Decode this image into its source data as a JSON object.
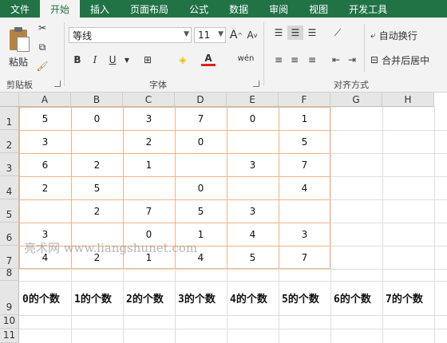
{
  "tabs": [
    {
      "label": "文件",
      "active": false
    },
    {
      "label": "开始",
      "active": true
    },
    {
      "label": "插入",
      "active": false
    },
    {
      "label": "页面布局",
      "active": false
    },
    {
      "label": "公式",
      "active": false
    },
    {
      "label": "数据",
      "active": false
    },
    {
      "label": "审阅",
      "active": false
    },
    {
      "label": "视图",
      "active": false
    },
    {
      "label": "开发工具",
      "active": false
    }
  ],
  "ribbon": {
    "clipboard": {
      "paste_label": "粘贴",
      "group_label": "剪贴板"
    },
    "font": {
      "name": "等线",
      "size": "11",
      "group_label": "字体",
      "bold": "B",
      "italic": "I",
      "underline": "U",
      "grow": "A",
      "shrink": "A",
      "font_color": "A",
      "wen": "wén"
    },
    "alignment": {
      "wrap_label": "自动换行",
      "merge_label": "合并后居中",
      "group_label": "对齐方式"
    }
  },
  "colors": {
    "accent": "#217346",
    "range_border": "#f0b48a"
  },
  "columns": [
    "A",
    "B",
    "C",
    "D",
    "E",
    "F",
    "G",
    "H"
  ],
  "rows": [
    "1",
    "2",
    "3",
    "4",
    "5",
    "6",
    "7",
    "8",
    "9",
    "10",
    "11"
  ],
  "cells": {
    "A1": "5",
    "B1": "0",
    "C1": "3",
    "D1": "7",
    "E1": "0",
    "F1": "1",
    "A2": "3",
    "C2": "2",
    "D2": "0",
    "F2": "5",
    "A3": "6",
    "B3": "2",
    "C3": "1",
    "E3": "3",
    "F3": "7",
    "A4": "2",
    "B4": "5",
    "D4": "0",
    "F4": "4",
    "B5": "2",
    "C5": "7",
    "D5": "5",
    "E5": "3",
    "A6": "3",
    "C6": "0",
    "D6": "1",
    "E6": "4",
    "F6": "3",
    "A7": "4",
    "B7": "2",
    "C7": "1",
    "D7": "4",
    "E7": "5",
    "F7": "7",
    "A9": "0的个数",
    "B9": "1的个数",
    "C9": "2的个数",
    "D9": "3的个数",
    "E9": "4的个数",
    "F9": "5的个数",
    "G9": "6的个数",
    "H9": "7的个数"
  },
  "watermark": "亮术网 www.liangshunet.com"
}
